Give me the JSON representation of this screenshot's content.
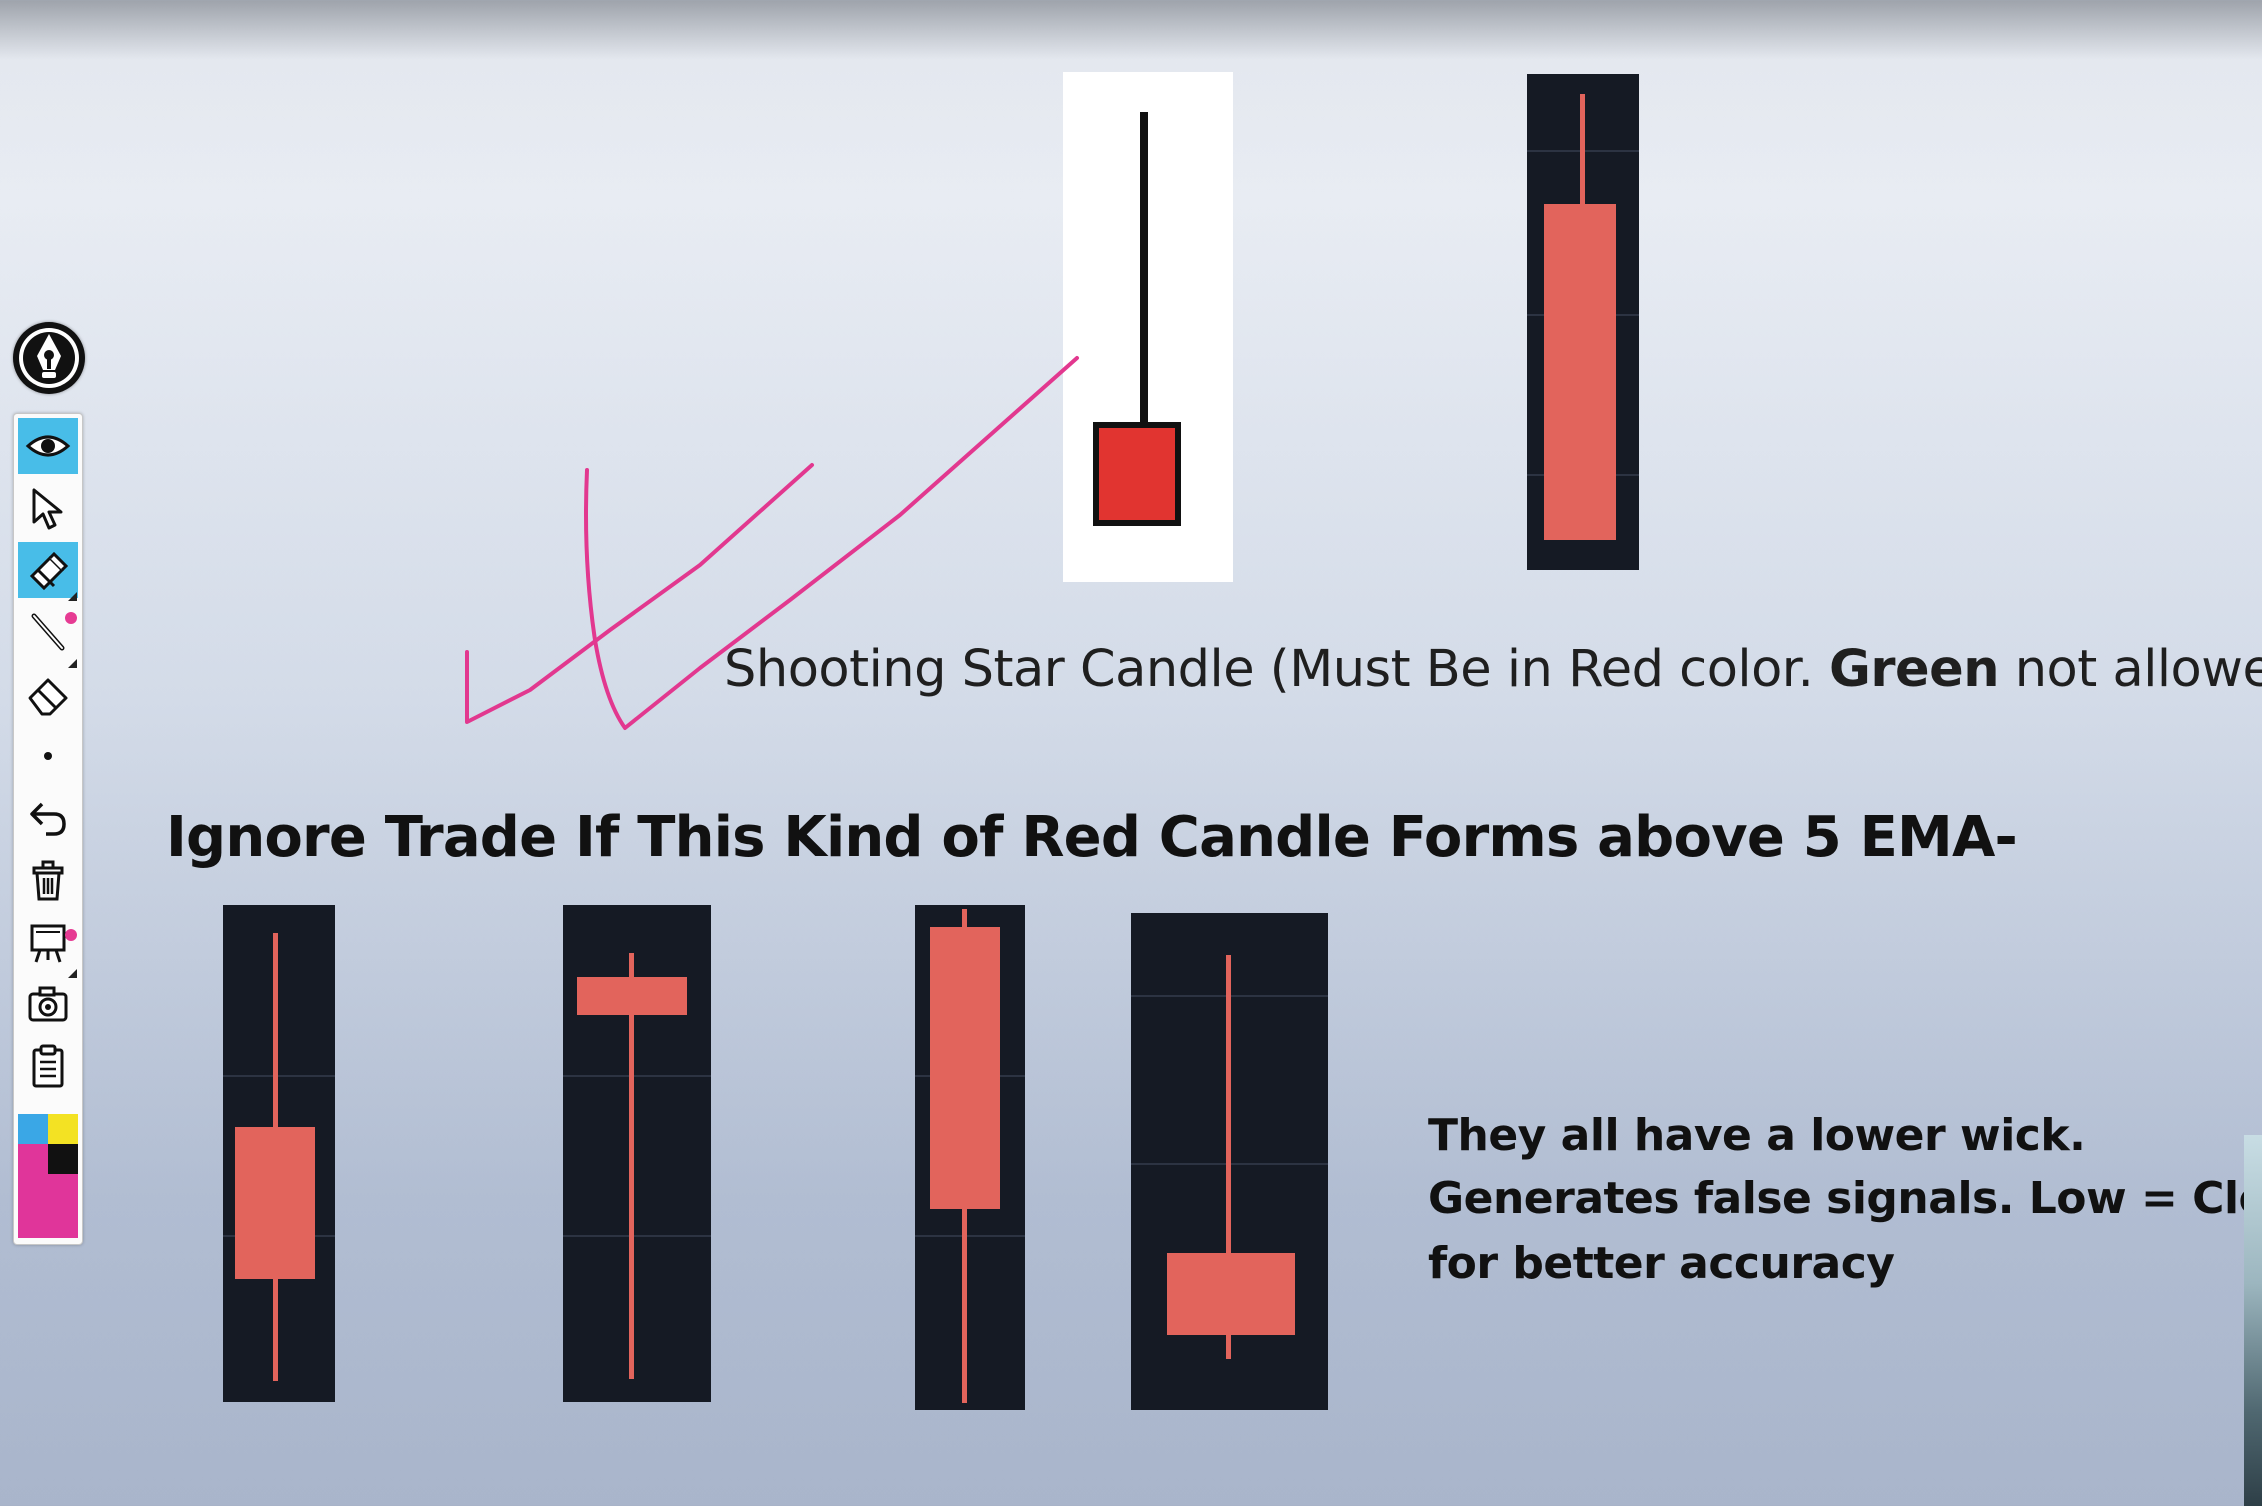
{
  "annotation": {
    "caption_prefix": "Shooting Star Candle (Must Be in Red color. ",
    "caption_bold": "Green",
    "caption_suffix": " not allowed)",
    "heading": "Ignore Trade If This Kind of Red Candle Forms above 5 EMA-",
    "note_lines": [
      "They all have a lower wick.",
      "Generates false signals. Low = Close",
      "for better accuracy"
    ]
  },
  "toolbar": {
    "tools": [
      {
        "icon": "eye-icon",
        "active": true
      },
      {
        "icon": "cursor-arrow-icon",
        "active": false
      },
      {
        "icon": "pen-highlighter-icon",
        "active": true
      },
      {
        "icon": "line-tool-icon",
        "active": false
      },
      {
        "icon": "eraser-icon",
        "active": false
      },
      {
        "icon": "small-dot-icon",
        "active": false
      },
      {
        "icon": "undo-icon",
        "active": false
      },
      {
        "icon": "trash-icon",
        "active": false
      },
      {
        "icon": "whiteboard-icon",
        "active": false
      },
      {
        "icon": "camera-icon",
        "active": false
      },
      {
        "icon": "clipboard-icon",
        "active": false
      }
    ],
    "colors": {
      "blue": "#3aa7e6",
      "yellow": "#f3e223",
      "black": "#111111",
      "magenta": "#e0359a"
    }
  },
  "colors": {
    "candle_red": "#e2645c",
    "shooting_star_red": "#e13430",
    "annotation_stroke": "#e2388f",
    "panel_dark": "#151a24"
  }
}
